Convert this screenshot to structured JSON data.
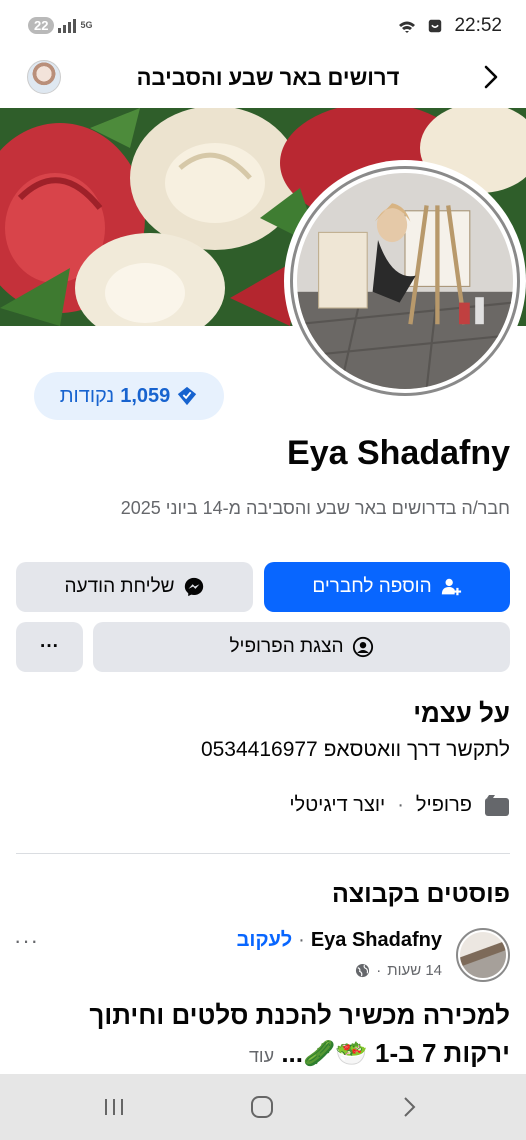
{
  "status_bar": {
    "notification_count": "22",
    "network_label": "5G",
    "time": "22:52"
  },
  "nav": {
    "title": "דרושים באר שבע והסביבה"
  },
  "profile": {
    "points_value": "1,059",
    "points_label": "נקודות",
    "name": "Eya Shadafny",
    "member_since": "חבר/ה בדרושים באר שבע והסביבה מ-14 ביוני 2025"
  },
  "buttons": {
    "add_friend": "הוספה לחברים",
    "send_message": "שליחת הודעה",
    "view_profile": "הצגת הפרופיל",
    "more": "···"
  },
  "about": {
    "title": "על עצמי",
    "contact": "לתקשר דרך וואטסאפ 0534416977",
    "profile_label": "פרופיל",
    "separator": "·",
    "category": "יוצר דיגיטלי"
  },
  "posts": {
    "section_title": "פוסטים בקבוצה",
    "items": [
      {
        "author": "Eya Shadafny",
        "separator": "·",
        "follow_label": "לעקוב",
        "time": "14 שעות",
        "meta_separator": "·",
        "text": "למכירה מכשיר להכנת סלטים וחיתוך ירקות 7 ב-1 🥗🥒...",
        "more_label": "עוד",
        "more_icon": "···"
      }
    ]
  },
  "colors": {
    "primary": "#0866ff",
    "secondary_button": "#e4e6eb",
    "points_bg": "#e7f1fd",
    "points_text": "#1763cf",
    "muted_text": "#65676b"
  },
  "icons": {
    "nav_back": "chevron-right-icon",
    "add_friend": "person-add-icon",
    "message": "messenger-icon",
    "view_profile": "person-circle-icon",
    "points": "diamond-badge-icon",
    "profile_type": "page-flag-icon",
    "post_privacy": "globe-icon",
    "android_recents": "recents-icon",
    "android_home": "home-icon",
    "android_back": "back-icon"
  }
}
